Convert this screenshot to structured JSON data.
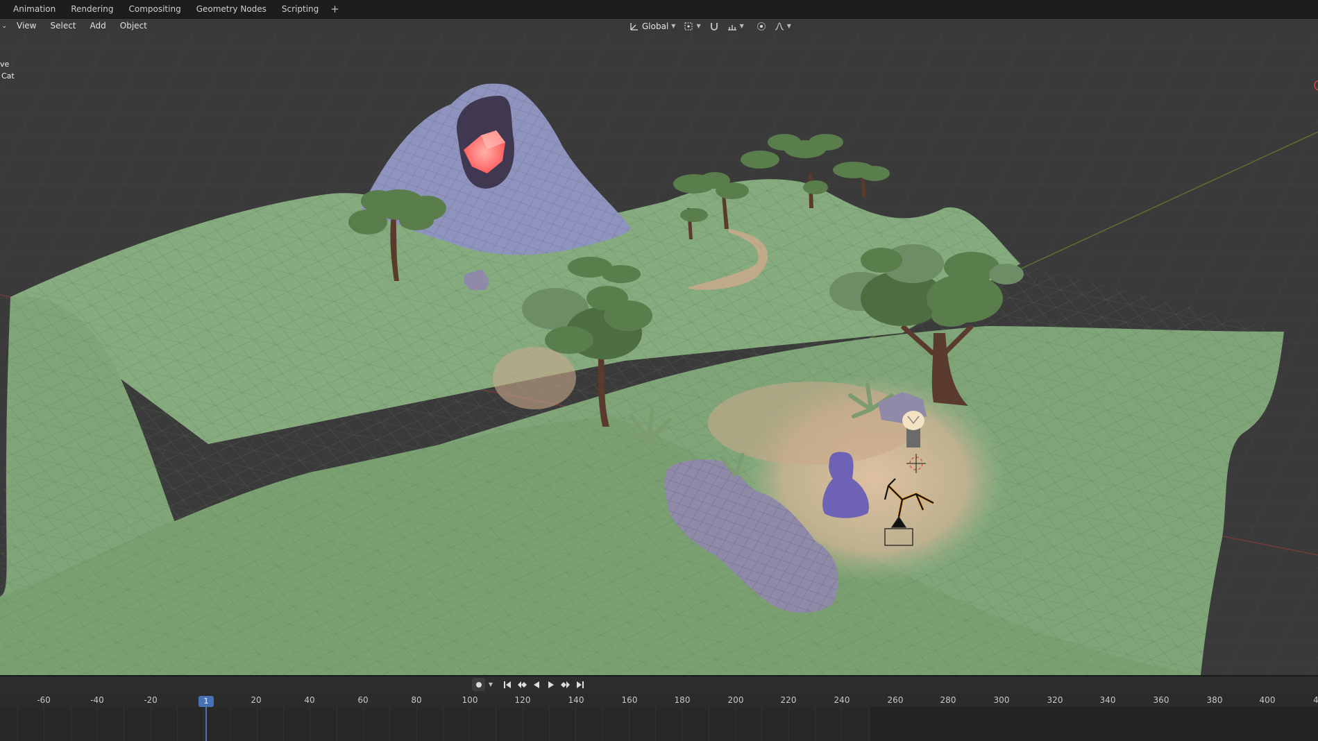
{
  "workspace_tabs": [
    "Animation",
    "Rendering",
    "Compositing",
    "Geometry Nodes",
    "Scripting"
  ],
  "add_tab_label": "+",
  "header": {
    "mode_arrow": "⌄",
    "menus": [
      "View",
      "Select",
      "Add",
      "Object"
    ],
    "transform_orientation": "Global"
  },
  "viewport": {
    "overlay_lines": [
      "ve",
      "Cat"
    ]
  },
  "timeline": {
    "current_frame": "1",
    "ruler_labels": [
      "-60",
      "-40",
      "-20",
      "20",
      "40",
      "60",
      "80",
      "100",
      "120",
      "140",
      "160",
      "180",
      "200",
      "220",
      "240",
      "260",
      "280",
      "300",
      "320",
      "340",
      "360",
      "380",
      "400",
      "4"
    ]
  },
  "colors": {
    "grass": "#7fa579",
    "path": "#c9a98b",
    "rock": "#8e8aa8",
    "crystal": "#ff6a6a",
    "foliage": "#5a7d4c",
    "trunk": "#5b3a2e",
    "accent_blue": "#4772b3"
  }
}
